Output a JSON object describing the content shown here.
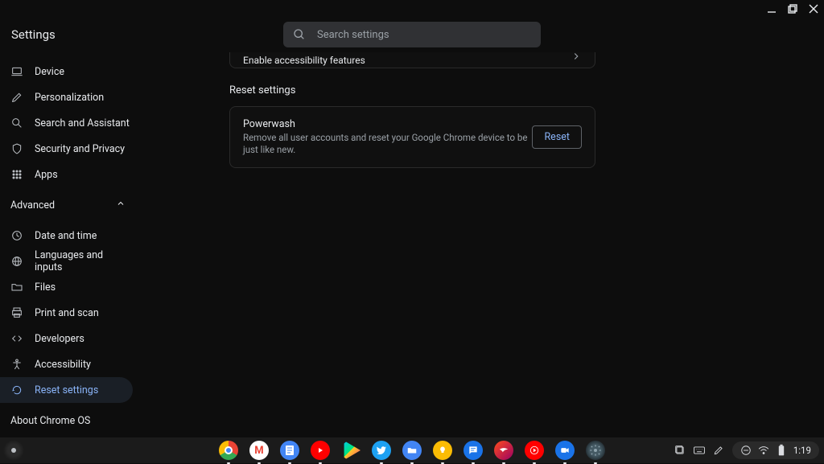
{
  "window": {
    "title": "Settings"
  },
  "search": {
    "placeholder": "Search settings"
  },
  "sidebar": {
    "items": [
      {
        "label": "Device"
      },
      {
        "label": "Personalization"
      },
      {
        "label": "Search and Assistant"
      },
      {
        "label": "Security and Privacy"
      },
      {
        "label": "Apps"
      }
    ],
    "advanced_label": "Advanced",
    "advanced": [
      {
        "label": "Date and time"
      },
      {
        "label": "Languages and inputs"
      },
      {
        "label": "Files"
      },
      {
        "label": "Print and scan"
      },
      {
        "label": "Developers"
      },
      {
        "label": "Accessibility"
      },
      {
        "label": "Reset settings"
      }
    ],
    "about": "About Chrome OS"
  },
  "content": {
    "accessibility_line": "Enable accessibility features",
    "reset_section": "Reset settings",
    "powerwash_title": "Powerwash",
    "powerwash_desc": "Remove all user accounts and reset your Google Chrome device to be just like new.",
    "reset_button": "Reset"
  },
  "shelf": {
    "clock": "1:19"
  }
}
